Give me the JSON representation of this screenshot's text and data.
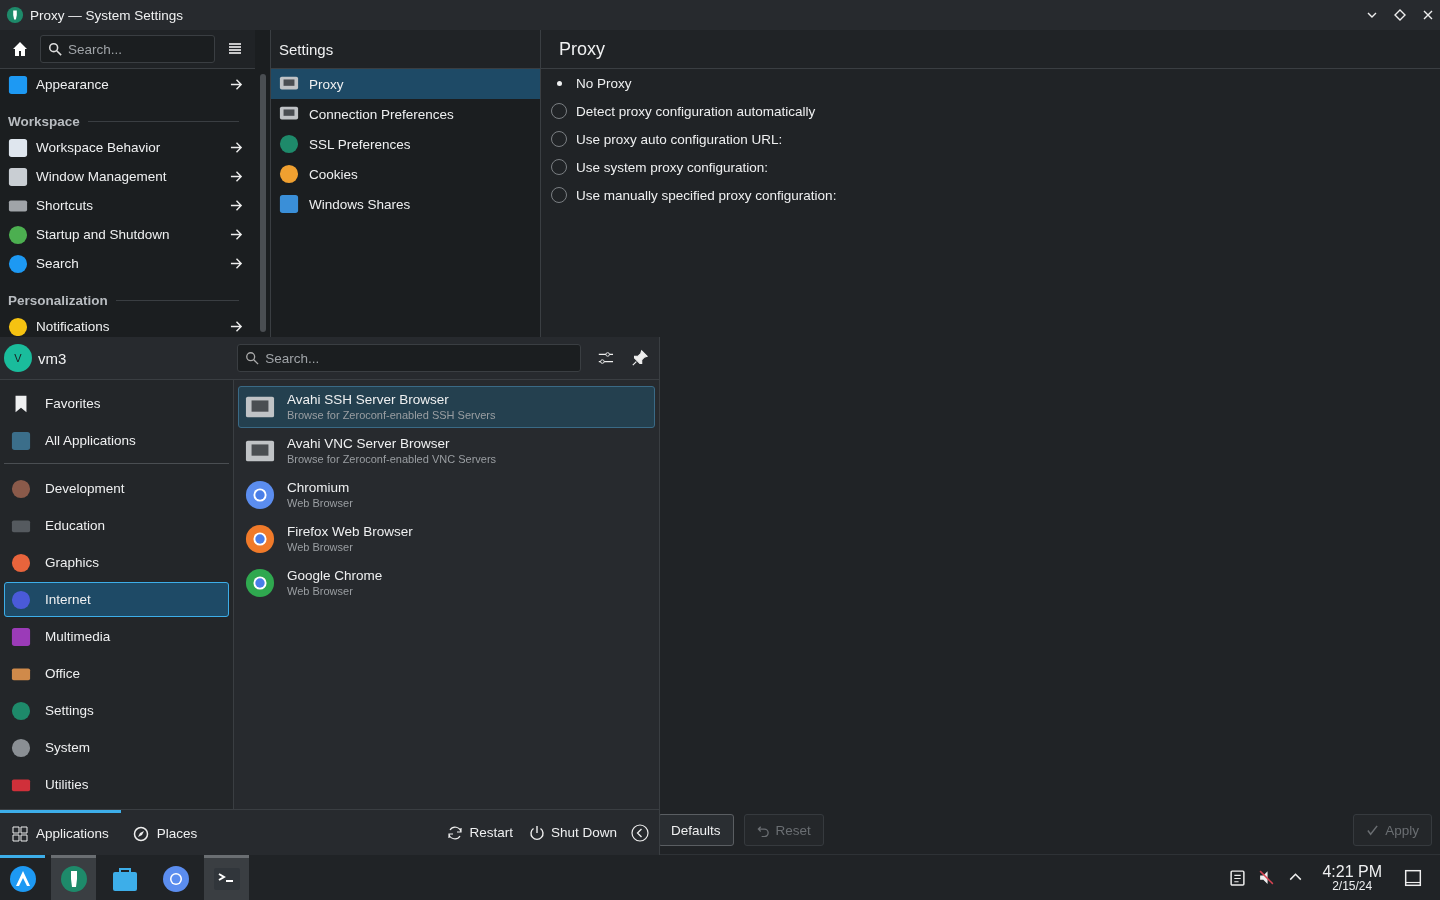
{
  "window": {
    "title": "Proxy — System Settings"
  },
  "sidebar": {
    "search": {
      "placeholder": "Search..."
    },
    "items": [
      {
        "kind": "item",
        "label": "Appearance"
      },
      {
        "kind": "header",
        "label": "Workspace"
      },
      {
        "kind": "item",
        "label": "Workspace Behavior"
      },
      {
        "kind": "item",
        "label": "Window Management"
      },
      {
        "kind": "item",
        "label": "Shortcuts"
      },
      {
        "kind": "item",
        "label": "Startup and Shutdown"
      },
      {
        "kind": "item",
        "label": "Search"
      },
      {
        "kind": "header",
        "label": "Personalization"
      },
      {
        "kind": "item",
        "label": "Notifications"
      }
    ]
  },
  "category": {
    "title": "Settings",
    "items": [
      {
        "label": "Proxy",
        "selected": true
      },
      {
        "label": "Connection Preferences",
        "selected": false
      },
      {
        "label": "SSL Preferences",
        "selected": false
      },
      {
        "label": "Cookies",
        "selected": false
      },
      {
        "label": "Windows Shares",
        "selected": false
      }
    ]
  },
  "page": {
    "title": "Proxy",
    "options": [
      {
        "label": "No Proxy",
        "selected": true
      },
      {
        "label": "Detect proxy configuration automatically",
        "selected": false
      },
      {
        "label": "Use proxy auto configuration URL:",
        "selected": false
      },
      {
        "label": "Use system proxy configuration:",
        "selected": false
      },
      {
        "label": "Use manually specified proxy configuration:",
        "selected": false
      }
    ]
  },
  "footer": {
    "buttons": [
      {
        "kind": "defaults",
        "label": "Defaults",
        "disabled": false
      },
      {
        "kind": "reset",
        "label": "Reset",
        "disabled": true
      },
      {
        "kind": "apply",
        "label": "Apply",
        "disabled": true
      }
    ]
  },
  "launcher": {
    "user": {
      "initial": "V",
      "name": "vm3"
    },
    "search": {
      "placeholder": "Search..."
    },
    "categories": [
      {
        "label": "Favorites",
        "selected": false
      },
      {
        "label": "All Applications",
        "selected": false
      },
      {
        "label": "Development",
        "selected": false
      },
      {
        "label": "Education",
        "selected": false
      },
      {
        "label": "Graphics",
        "selected": false
      },
      {
        "label": "Internet",
        "selected": true
      },
      {
        "label": "Multimedia",
        "selected": false
      },
      {
        "label": "Office",
        "selected": false
      },
      {
        "label": "Settings",
        "selected": false
      },
      {
        "label": "System",
        "selected": false
      },
      {
        "label": "Utilities",
        "selected": false
      }
    ],
    "apps": [
      {
        "name": "Avahi SSH Server Browser",
        "description": "Browse for Zeroconf-enabled SSH Servers",
        "selected": true
      },
      {
        "name": "Avahi VNC Server Browser",
        "description": "Browse for Zeroconf-enabled VNC Servers",
        "selected": false
      },
      {
        "name": "Chromium",
        "description": "Web Browser",
        "selected": false
      },
      {
        "name": "Firefox Web Browser",
        "description": "Web Browser",
        "selected": false
      },
      {
        "name": "Google Chrome",
        "description": "Web Browser",
        "selected": false
      }
    ],
    "tabs": [
      {
        "label": "Applications",
        "selected": true
      },
      {
        "label": "Places",
        "selected": false
      }
    ],
    "actions": [
      {
        "kind": "restart",
        "label": "Restart"
      },
      {
        "kind": "shutdown",
        "label": "Shut Down"
      }
    ]
  },
  "taskbar": {
    "items": [
      {
        "kind": "launcher",
        "active": false,
        "open": true
      },
      {
        "kind": "settings",
        "active": true,
        "open": false
      },
      {
        "kind": "store",
        "active": false,
        "open": false
      },
      {
        "kind": "browser",
        "active": false,
        "open": false
      },
      {
        "kind": "terminal",
        "active": true,
        "open": false
      }
    ],
    "clock": {
      "time": "4:21 PM",
      "date": "2/15/24"
    }
  }
}
